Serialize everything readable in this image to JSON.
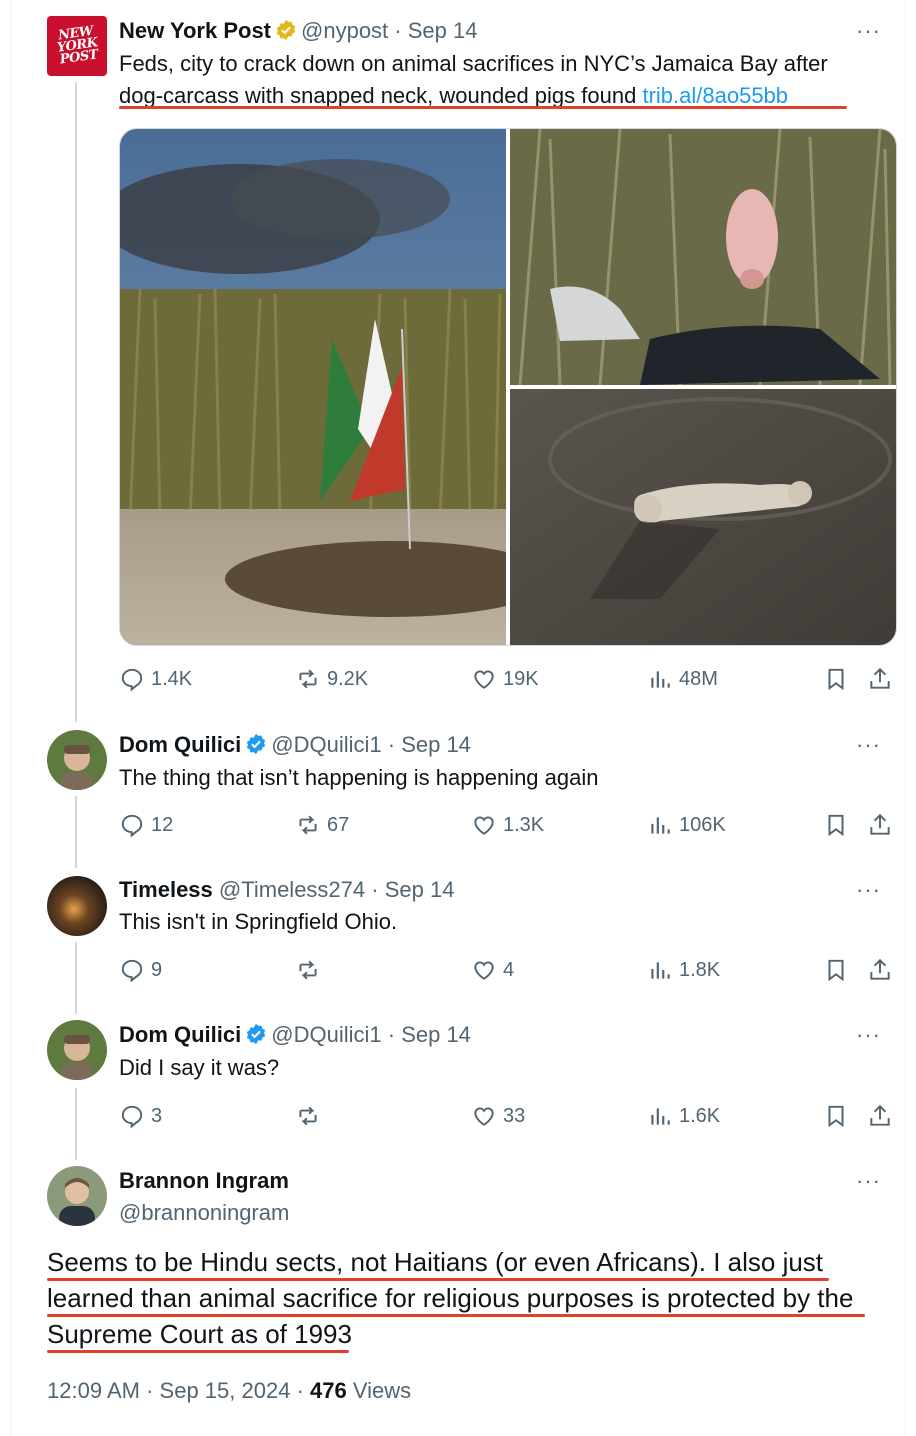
{
  "tweets": [
    {
      "name": "New York Post",
      "handle": "@nypost",
      "date": "Sep 14",
      "logo_text": "NEW YORK POST",
      "text": "Feds, city to crack down on animal sacrifices in NYC’s Jamaica Bay after dog-carcass with snapped neck, wounded pigs found",
      "link": "trib.al/8ao55bb",
      "line1": "Feds, city to crack down on animal sacrifices in NYC’s Jamaica Bay after",
      "line2": "dog-carcass with snapped neck, wounded pigs found",
      "replies": "1.4K",
      "reposts": "9.2K",
      "likes": "19K",
      "views": "48M"
    },
    {
      "name": "Dom Quilici",
      "handle": "@DQuilici1",
      "date": "Sep 14",
      "text": "The thing that isn’t happening is happening again",
      "replies": "12",
      "reposts": "67",
      "likes": "1.3K",
      "views": "106K"
    },
    {
      "name": "Timeless",
      "handle": "@Timeless274",
      "date": "Sep 14",
      "text": "This isn't in Springfield Ohio.",
      "replies": "9",
      "reposts": "",
      "likes": "4",
      "views": "1.8K"
    },
    {
      "name": "Dom Quilici",
      "handle": "@DQuilici1",
      "date": "Sep 14",
      "text": "Did I say it was?",
      "replies": "3",
      "reposts": "",
      "likes": "33",
      "views": "1.6K"
    }
  ],
  "main_tweet": {
    "name": "Brannon Ingram",
    "handle": "@brannoningram",
    "line1": "Seems to be Hindu sects, not Haitians (or even Africans). I also just",
    "line2": "learned than animal sacrifice for religious purposes is protected by the",
    "line3": "Supreme Court as of 1993",
    "time": "12:09 AM",
    "date": "Sep 15, 2024",
    "views_count": "476",
    "views_label": "Views"
  },
  "separator": "·",
  "more_label": "···",
  "colors": {
    "accent": "#1d9bf0",
    "verified_gold": "#e2b719",
    "verified_blue": "#1d9bf0",
    "underline": "#e0402c",
    "muted": "#536471"
  },
  "icons": [
    "reply-icon",
    "repost-icon",
    "like-icon",
    "views-icon",
    "bookmark-icon",
    "share-icon",
    "more-icon",
    "verified-badge-icon"
  ]
}
